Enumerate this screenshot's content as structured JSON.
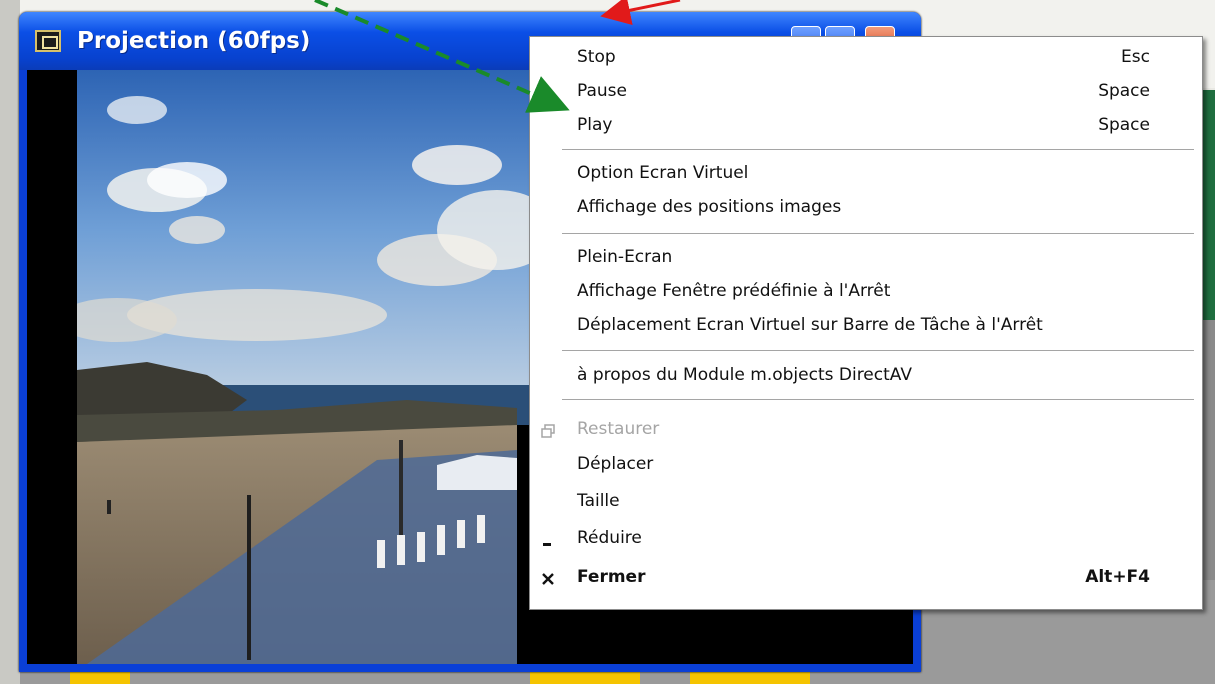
{
  "window": {
    "title": "Projection (60fps)"
  },
  "menu": {
    "groups": [
      {
        "items": [
          {
            "label": "Stop",
            "shortcut": "Esc"
          },
          {
            "label": "Pause",
            "shortcut": "Space"
          },
          {
            "label": "Play",
            "shortcut": "Space"
          }
        ]
      },
      {
        "items": [
          {
            "label": "Option Ecran Virtuel"
          },
          {
            "label": "Affichage des positions images"
          }
        ]
      },
      {
        "items": [
          {
            "label": "Plein-Ecran"
          },
          {
            "label": "Affichage Fenêtre prédéfinie à l'Arrêt"
          },
          {
            "label": "Déplacement Ecran Virtuel sur Barre de Tâche à l'Arrêt"
          }
        ]
      },
      {
        "items": [
          {
            "label": "à propos du Module m.objects DirectAV"
          }
        ]
      },
      {
        "items": [
          {
            "label": "Restaurer",
            "disabled": true,
            "icon": "restore-icon"
          },
          {
            "label": "Déplacer"
          },
          {
            "label": "Taille"
          },
          {
            "label": "Réduire",
            "icon": "minimize-icon"
          },
          {
            "label": "Fermer",
            "shortcut": "Alt+F4",
            "bold": true,
            "icon": "close-icon"
          }
        ]
      }
    ]
  },
  "colors": {
    "titlebar": "#0b4fe6",
    "arrow_green": "#1a8a2a",
    "arrow_red": "#e11a1a"
  }
}
